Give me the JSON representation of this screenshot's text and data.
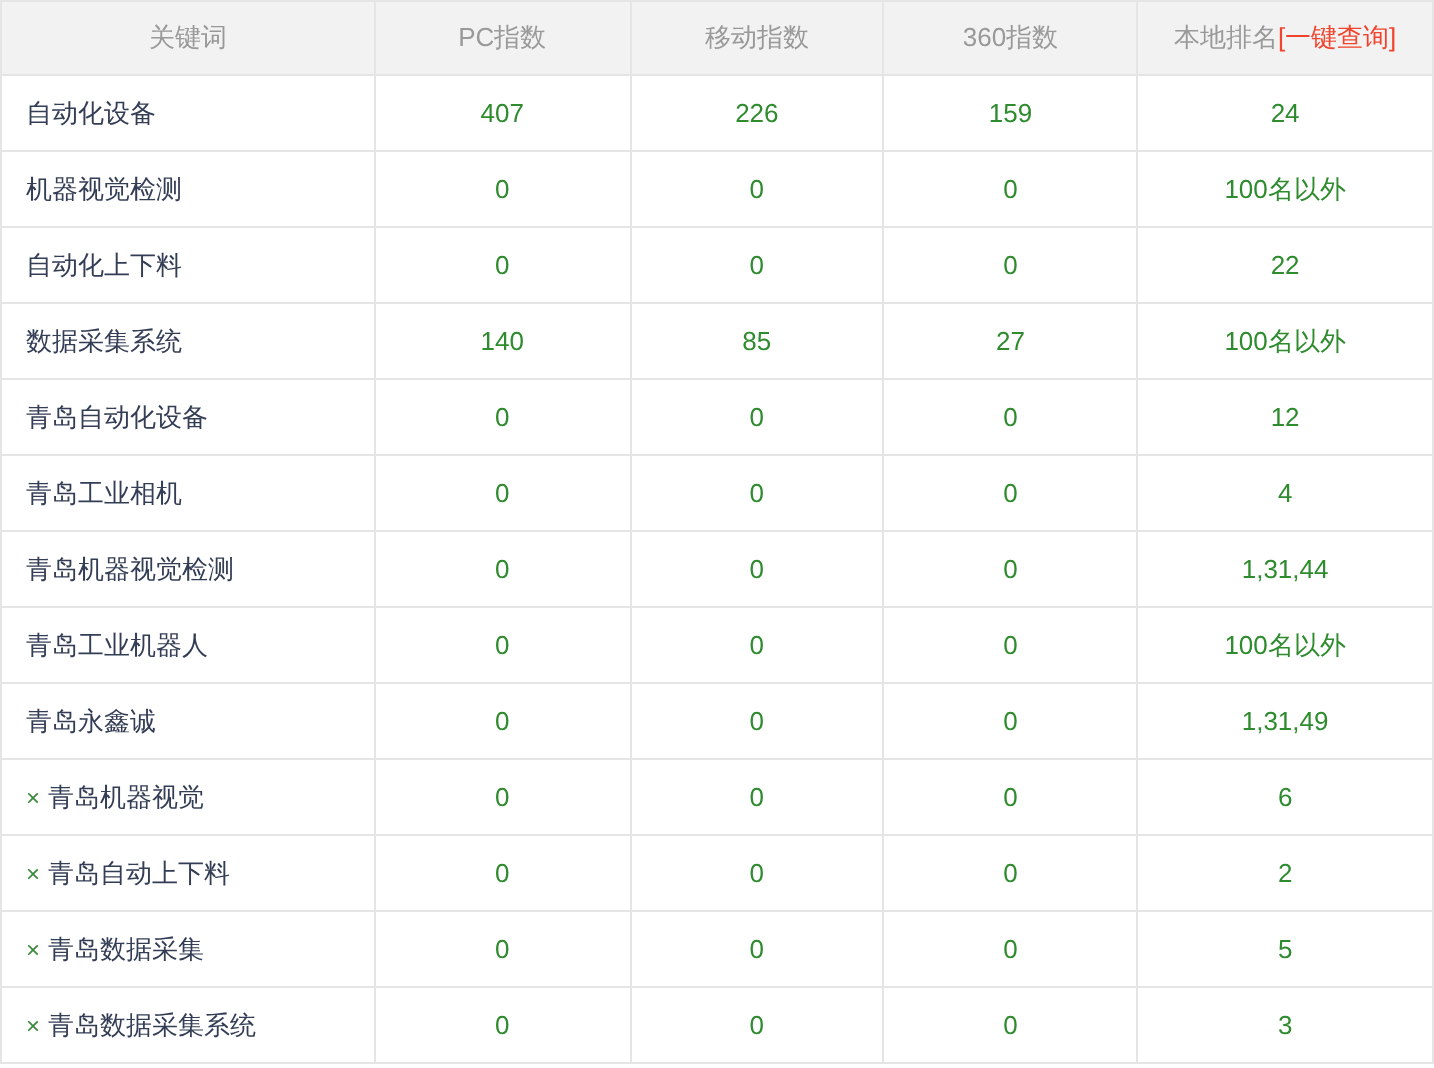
{
  "table": {
    "columns": [
      {
        "label": "关键词"
      },
      {
        "label": "PC指数"
      },
      {
        "label": "移动指数"
      },
      {
        "label": "360指数"
      },
      {
        "label": "本地排名",
        "link": "[一键查询]"
      }
    ],
    "rows": [
      {
        "removable": false,
        "keyword": "自动化设备",
        "pc": "407",
        "mobile": "226",
        "index_360": "159",
        "rank": "24"
      },
      {
        "removable": false,
        "keyword": "机器视觉检测",
        "pc": "0",
        "mobile": "0",
        "index_360": "0",
        "rank": "100名以外"
      },
      {
        "removable": false,
        "keyword": "自动化上下料",
        "pc": "0",
        "mobile": "0",
        "index_360": "0",
        "rank": "22"
      },
      {
        "removable": false,
        "keyword": "数据采集系统",
        "pc": "140",
        "mobile": "85",
        "index_360": "27",
        "rank": "100名以外"
      },
      {
        "removable": false,
        "keyword": "青岛自动化设备",
        "pc": "0",
        "mobile": "0",
        "index_360": "0",
        "rank": "12"
      },
      {
        "removable": false,
        "keyword": "青岛工业相机",
        "pc": "0",
        "mobile": "0",
        "index_360": "0",
        "rank": "4"
      },
      {
        "removable": false,
        "keyword": "青岛机器视觉检测",
        "pc": "0",
        "mobile": "0",
        "index_360": "0",
        "rank": "1,31,44"
      },
      {
        "removable": false,
        "keyword": "青岛工业机器人",
        "pc": "0",
        "mobile": "0",
        "index_360": "0",
        "rank": "100名以外"
      },
      {
        "removable": false,
        "keyword": "青岛永鑫诚",
        "pc": "0",
        "mobile": "0",
        "index_360": "0",
        "rank": "1,31,49"
      },
      {
        "removable": true,
        "remove_label": "×",
        "keyword": "青岛机器视觉",
        "pc": "0",
        "mobile": "0",
        "index_360": "0",
        "rank": "6"
      },
      {
        "removable": true,
        "remove_label": "×",
        "keyword": "青岛自动上下料",
        "pc": "0",
        "mobile": "0",
        "index_360": "0",
        "rank": "2"
      },
      {
        "removable": true,
        "remove_label": "×",
        "keyword": "青岛数据采集",
        "pc": "0",
        "mobile": "0",
        "index_360": "0",
        "rank": "5"
      },
      {
        "removable": true,
        "remove_label": "×",
        "keyword": "青岛数据采集系统",
        "pc": "0",
        "mobile": "0",
        "index_360": "0",
        "rank": "3"
      }
    ]
  }
}
